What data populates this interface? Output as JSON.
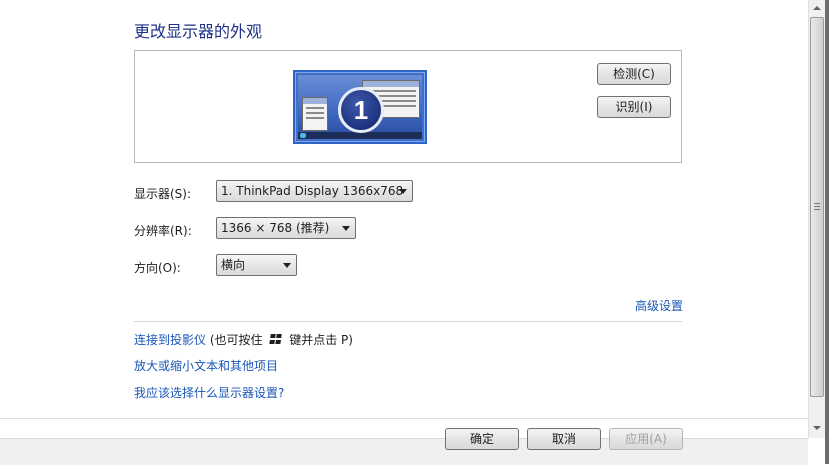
{
  "page": {
    "title": "更改显示器的外观"
  },
  "preview": {
    "monitor_number": "1",
    "detect_button": "检测(C)",
    "identify_button": "识别(I)"
  },
  "fields": {
    "display": {
      "label": "显示器(S):",
      "value": "1. ThinkPad Display 1366x768"
    },
    "resolution": {
      "label": "分辨率(R):",
      "value": "1366 × 768 (推荐)"
    },
    "orientation": {
      "label": "方向(O):",
      "value": "横向"
    }
  },
  "links": {
    "advanced": "高级设置",
    "projector": "连接到投影仪",
    "projector_hint_prefix": "(也可按住",
    "projector_hint_suffix": "键并点击 P)",
    "text_size": "放大或缩小文本和其他项目",
    "which_settings": "我应该选择什么显示器设置?"
  },
  "footer": {
    "ok_button": "确定",
    "cancel_button": "取消",
    "apply_button": "应用(A)"
  },
  "colors": {
    "title": "#1e3287",
    "link": "#1a56b8",
    "monitor_blue": "#2f63c8"
  }
}
